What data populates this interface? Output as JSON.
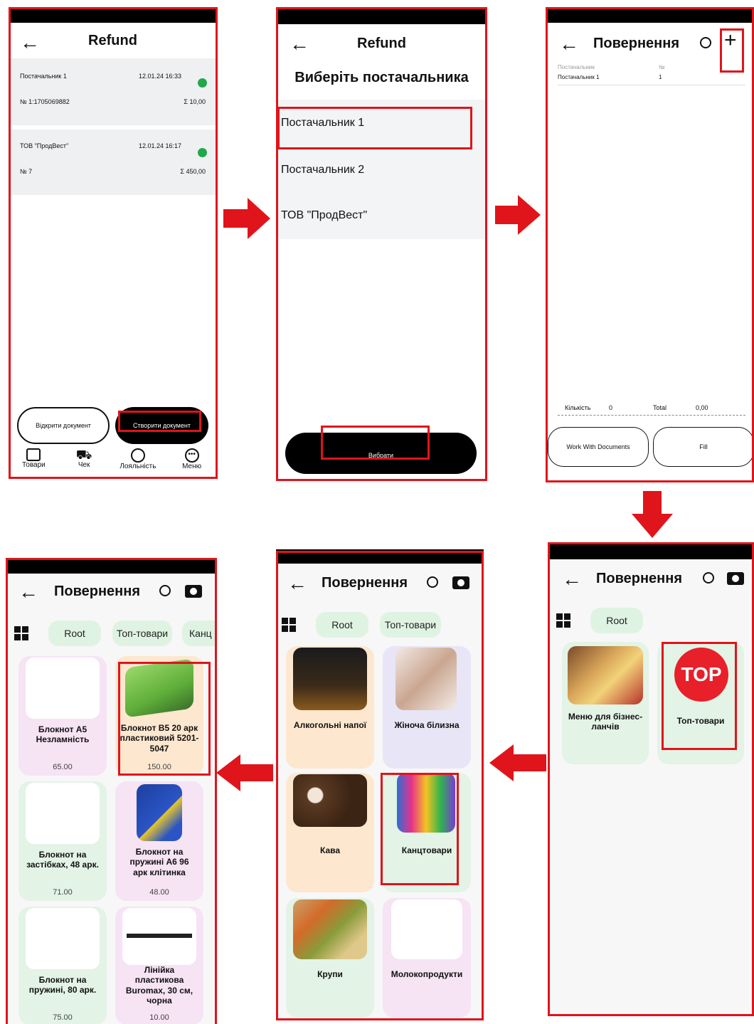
{
  "screen1": {
    "title": "Refund",
    "documents": [
      {
        "supplier": "Постачальник 1",
        "datetime": "12.01.24 16:33",
        "number": "№ 1:1705069882",
        "sum": "Σ 10,00"
      },
      {
        "supplier": "ТОВ \"ПродВест\"",
        "datetime": "12.01.24 16:17",
        "number": "№ 7",
        "sum": "Σ 450,00"
      }
    ],
    "open_btn": "Відкрити документ",
    "create_btn": "Створити документ",
    "nav": [
      "Товари",
      "Чек",
      "Лояльність",
      "Меню"
    ]
  },
  "screen2": {
    "title": "Refund",
    "subtitle": "Виберіть постачальника",
    "suppliers": [
      "Постачальник 1",
      "Постачальник 2",
      "ТОВ \"ПродВест\""
    ],
    "select_btn": "Вибрати"
  },
  "screen3": {
    "title": "Повернення",
    "col_supplier": "Постачальник",
    "col_number": "№",
    "row_supplier": "Постачальник 1",
    "row_number": "1",
    "qty_label": "Кількість",
    "qty_value": "0",
    "total_label": "Total",
    "total_value": "0,00",
    "work_btn": "Work With Documents",
    "fill_btn": "Fill"
  },
  "screen4": {
    "title": "Повернення",
    "root": "Root",
    "tiles": [
      "Меню для бізнес-ланчів",
      "Топ-товари"
    ],
    "top_logo": "TOP"
  },
  "screen5": {
    "title": "Повернення",
    "root": "Root",
    "top": "Топ-товари",
    "tiles": [
      "Алкогольні напої",
      "Жіноча білизна",
      "Кава",
      "Канцтовари",
      "Крупи",
      "Молокопродукти"
    ]
  },
  "screen6": {
    "title": "Повернення",
    "root": "Root",
    "top": "Топ-товари",
    "partial": "Канц",
    "products": [
      {
        "name": "Блокнот А5 Незламність",
        "price": "65.00"
      },
      {
        "name": "Блокнот В5 20 арк пластиковий 5201-5047",
        "price": "150.00"
      },
      {
        "name": "Блокнот на застібках, 48 арк.",
        "price": "71.00"
      },
      {
        "name": "Блокнот на пружині А6 96 арк клітинка",
        "price": "48.00"
      },
      {
        "name": "Блокнот на пружині, 80 арк.",
        "price": "75.00"
      },
      {
        "name": "Лінійка пластикова Buromax, 30 см, чорна",
        "price": "10.00"
      }
    ]
  },
  "colors": {
    "highlight": "#e0141b",
    "status_green": "#21a84a",
    "pill": "#dff3e2"
  }
}
